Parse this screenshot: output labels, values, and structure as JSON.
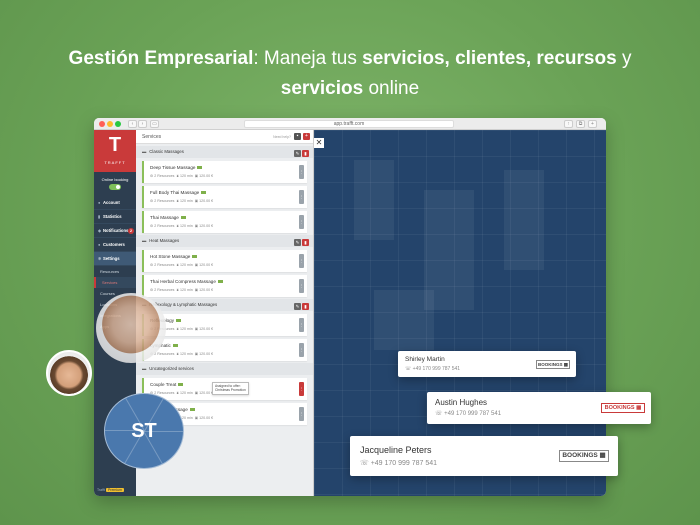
{
  "headline": {
    "b1": "Gestión Empresarial",
    "t1": ": Maneja tus ",
    "b2": "servicios, clientes, recursos",
    "t2": " y",
    "b3": "servicios",
    "t3": " online"
  },
  "browser": {
    "url": "app.trafft.com"
  },
  "sidebar": {
    "logo_letter": "T",
    "logo_name": "TRAFFT",
    "online_booking": "Online booking",
    "items": [
      {
        "label": "Account",
        "icon": "user-icon"
      },
      {
        "label": "Statistics",
        "icon": "chart-icon"
      },
      {
        "label": "Notifications",
        "icon": "bell-icon",
        "badge": "2"
      },
      {
        "label": "Customers",
        "icon": "users-icon"
      },
      {
        "label": "Settings",
        "icon": "gear-icon"
      }
    ],
    "sub_items": [
      {
        "label": "Resources"
      },
      {
        "label": "Services",
        "active": true
      }
    ],
    "more_items": [
      "Courses",
      "Locations",
      "Integrations",
      "Apps"
    ],
    "footer_label": "Trafft",
    "footer_badge": "Premium"
  },
  "panel": {
    "title": "Services",
    "help": "Need help?",
    "categories": [
      {
        "name": "Classic Massages",
        "services": [
          {
            "name": "Deep Tissue Massage",
            "resources": "2 Resources",
            "duration": "120 min",
            "price": "120.00 €"
          },
          {
            "name": "Full Body Thai Massage",
            "resources": "2 Resources",
            "duration": "120 min",
            "price": "120.00 €"
          },
          {
            "name": "Thai Massage",
            "resources": "2 Resources",
            "duration": "120 min",
            "price": "120.00 €"
          }
        ]
      },
      {
        "name": "Heat Massages",
        "services": [
          {
            "name": "Hot Stone Massage",
            "resources": "2 Resources",
            "duration": "120 min",
            "price": "120.00 €"
          },
          {
            "name": "Thai Herbal Compress Massage",
            "resources": "2 Resources",
            "duration": "120 min",
            "price": "120.00 €"
          }
        ]
      },
      {
        "name": "Reflexology & Lymphatic Massages",
        "services": [
          {
            "name": "Reflexology",
            "resources": "2 Resources",
            "duration": "120 min",
            "price": "120.00 €"
          },
          {
            "name": "Lymphatic",
            "resources": "2 Resources",
            "duration": "120 min",
            "price": "120.00 €"
          }
        ]
      },
      {
        "name": "Uncategorized services",
        "services": [
          {
            "name": "Couple Treat",
            "resources": "2 Resources",
            "duration": "120 min",
            "price": "120.00 €",
            "tooltip1": "Assigned to offer:",
            "tooltip2": "Christmas Promotion"
          },
          {
            "name": "Bespoke Massage",
            "resources": "2 Resources",
            "duration": "120 min",
            "price": "120.00 €"
          }
        ]
      }
    ]
  },
  "cards": [
    {
      "name": "Shirley Martin",
      "phone": "+49 170 999 787 541",
      "bookings": "BOOKINGS"
    },
    {
      "name": "Austin Hughes",
      "phone": "+49 170 999 787 541",
      "bookings": "BOOKINGS"
    },
    {
      "name": "Jacqueline Peters",
      "phone": "+49 170 999 787 541",
      "bookings": "BOOKINGS"
    }
  ],
  "avatar_initials": "ST",
  "colors": {
    "background": "#6aa256",
    "sidebar": "#2d3e50",
    "brand_red": "#c93a3a",
    "calendar": "#24446b",
    "accent_green": "#8bbf5a"
  }
}
